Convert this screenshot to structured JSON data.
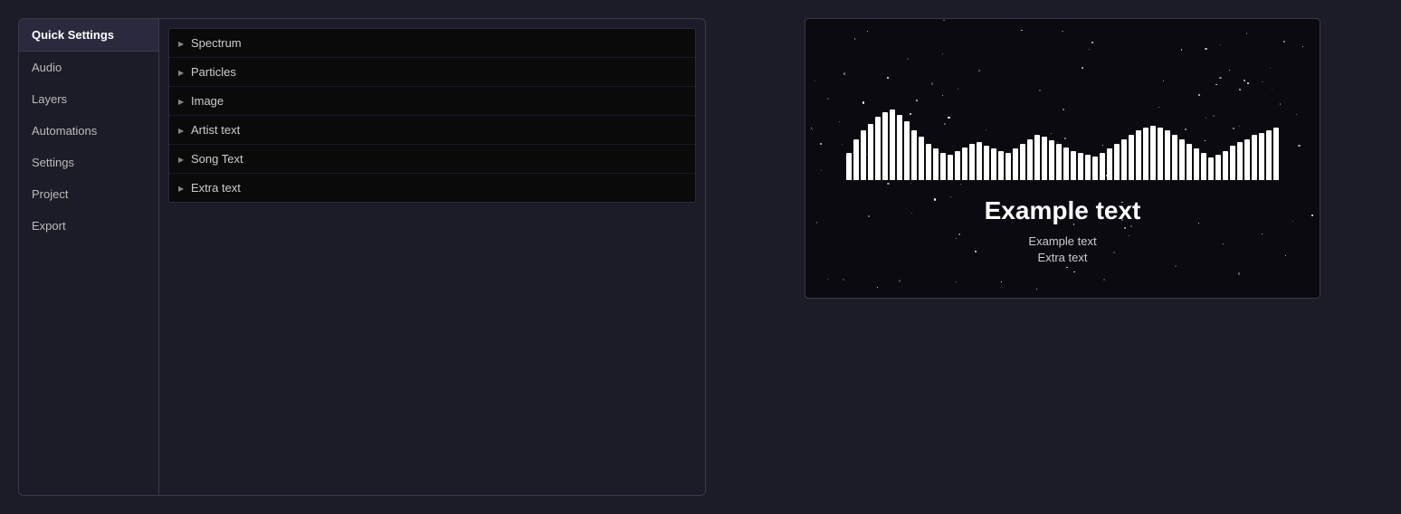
{
  "app": {
    "background_color": "#1c1c28"
  },
  "sidebar": {
    "items": [
      {
        "id": "quick-settings",
        "label": "Quick Settings",
        "active": true
      },
      {
        "id": "audio",
        "label": "Audio"
      },
      {
        "id": "layers",
        "label": "Layers"
      },
      {
        "id": "automations",
        "label": "Automations"
      },
      {
        "id": "settings",
        "label": "Settings"
      },
      {
        "id": "project",
        "label": "Project"
      },
      {
        "id": "export",
        "label": "Export"
      }
    ]
  },
  "layers": {
    "items": [
      {
        "id": "spectrum",
        "label": "Spectrum"
      },
      {
        "id": "particles",
        "label": "Particles"
      },
      {
        "id": "image",
        "label": "Image"
      },
      {
        "id": "artist-text",
        "label": "Artist text"
      },
      {
        "id": "song-text",
        "label": "Song Text"
      },
      {
        "id": "extra-text",
        "label": "Extra text"
      }
    ]
  },
  "preview": {
    "main_text": "Example text",
    "sub_text": "Example text",
    "extra_text": "Extra text",
    "bar_heights": [
      30,
      45,
      55,
      62,
      70,
      75,
      78,
      72,
      65,
      55,
      48,
      40,
      35,
      30,
      28,
      32,
      36,
      40,
      42,
      38,
      35,
      32,
      30,
      35,
      40,
      45,
      50,
      48,
      44,
      40,
      36,
      32,
      30,
      28,
      26,
      30,
      35,
      40,
      45,
      50,
      55,
      58,
      60,
      58,
      55,
      50,
      45,
      40,
      35,
      30,
      25,
      28,
      32,
      38,
      42,
      45,
      50,
      52,
      55,
      58
    ]
  }
}
